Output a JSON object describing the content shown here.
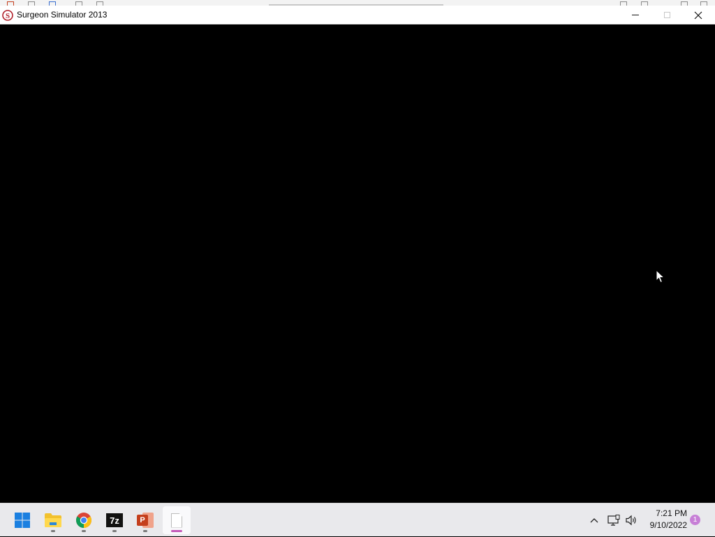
{
  "window": {
    "title": "Surgeon Simulator 2013",
    "app_icon": "surgeon-simulator-icon",
    "controls": [
      "minimize-icon",
      "maximize-icon",
      "close-icon"
    ]
  },
  "game": {
    "background_color": "#000000"
  },
  "taskbar": {
    "apps": [
      {
        "name": "Start",
        "icon": "windows-start-icon",
        "running": false
      },
      {
        "name": "File Explorer",
        "icon": "folder-icon",
        "running": true
      },
      {
        "name": "Google Chrome",
        "icon": "chrome-icon",
        "running": true
      },
      {
        "name": "7-Zip",
        "icon": "seven-zip-icon",
        "label": "7z",
        "running": true
      },
      {
        "name": "PowerPoint",
        "icon": "powerpoint-icon",
        "label": "P",
        "running": true
      },
      {
        "name": "Surgeon Simulator 2013",
        "icon": "document-icon",
        "running": true,
        "active": true
      }
    ],
    "tray": {
      "icons": [
        "chevron-up-icon",
        "network-icon",
        "volume-icon"
      ],
      "time": "7:21 PM",
      "date": "9/10/2022",
      "notification_count": "1"
    },
    "accent_color": "#c45ab8"
  }
}
